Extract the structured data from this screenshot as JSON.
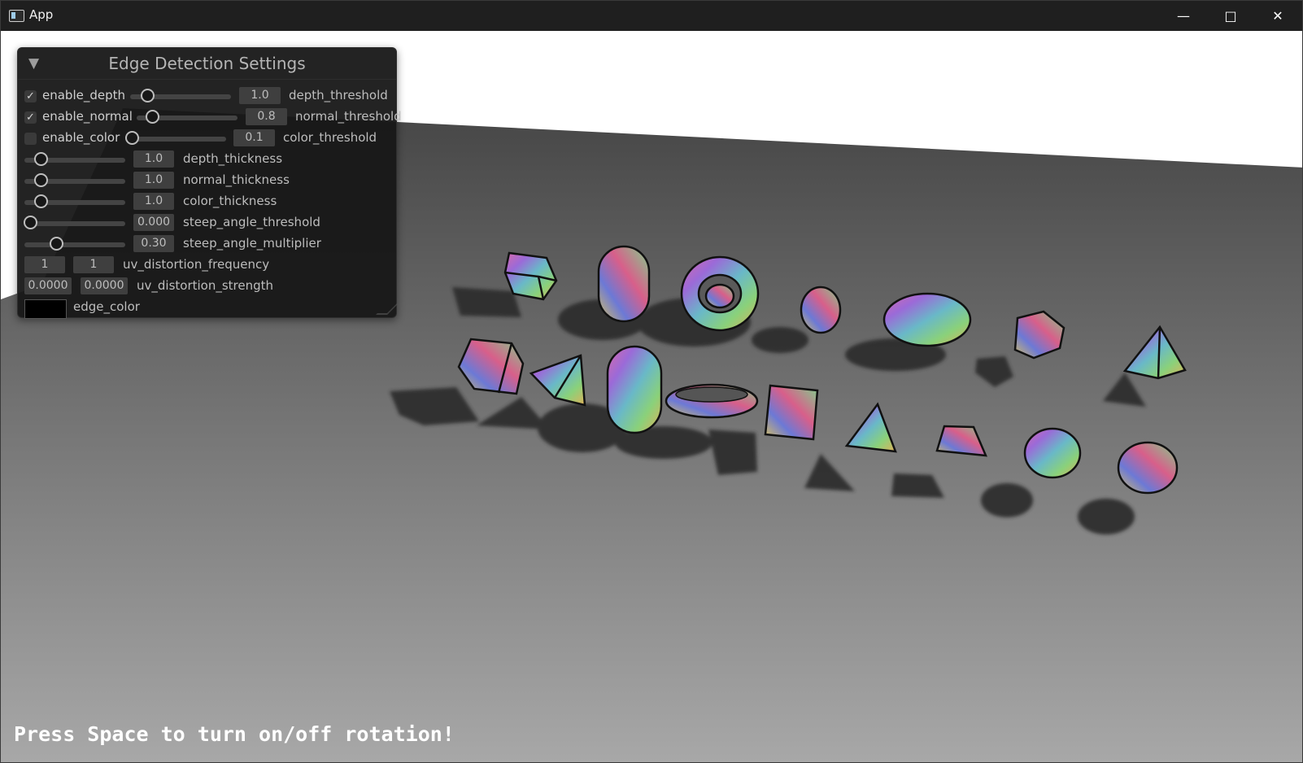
{
  "window": {
    "title": "App",
    "controls": {
      "minimize": "—",
      "maximize": "□",
      "close": "✕"
    }
  },
  "colors": {
    "ground_top": "#444444",
    "ground_bottom": "#a6a6a6",
    "edge_color": "#000000",
    "panel_bg": "#171717"
  },
  "panel": {
    "title": "Edge Detection Settings",
    "collapse_icon": "▼",
    "toggles": [
      {
        "label": "enable_depth",
        "checked": true,
        "value": "1.0",
        "name": "depth_threshold",
        "slider_fraction": 0.18
      },
      {
        "label": "enable_normal",
        "checked": true,
        "value": "0.8",
        "name": "normal_threshold",
        "slider_fraction": 0.15
      },
      {
        "label": "enable_color",
        "checked": false,
        "value": "0.1",
        "name": "color_threshold",
        "slider_fraction": 0.1
      }
    ],
    "params": [
      {
        "value": "1.0",
        "name": "depth_thickness",
        "slider_fraction": 0.18
      },
      {
        "value": "1.0",
        "name": "normal_thickness",
        "slider_fraction": 0.18
      },
      {
        "value": "1.0",
        "name": "color_thickness",
        "slider_fraction": 0.18
      },
      {
        "value": "0.000",
        "name": "steep_angle_threshold",
        "slider_fraction": 0.0
      },
      {
        "value": "0.30",
        "name": "steep_angle_multiplier",
        "slider_fraction": 0.3
      }
    ],
    "uv_freq": {
      "a": "1",
      "b": "1",
      "name": "uv_distortion_frequency"
    },
    "uv_strength": {
      "a": "0.0000",
      "b": "0.0000",
      "name": "uv_distortion_strength"
    },
    "edge_color": {
      "name": "edge_color"
    }
  },
  "hint": "Press Space to turn on/off rotation!"
}
